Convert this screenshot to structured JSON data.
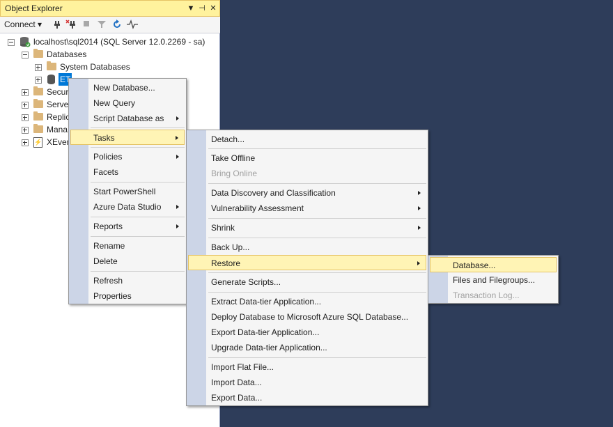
{
  "object_explorer": {
    "title": "Object Explorer",
    "title_buttons": [
      "▼",
      "⊣",
      "✕"
    ],
    "toolbar": {
      "connect_label": "Connect ▾"
    }
  },
  "tree": {
    "server": "localhost\\sql2014 (SQL Server 12.0.2269 - sa)",
    "databases": "Databases",
    "system_databases": "System Databases",
    "selected_db": "ET",
    "security": "Securi",
    "server_objects": "Server",
    "replication": "Replic",
    "management": "Mana",
    "xevent": "XEven"
  },
  "context_menu": {
    "items": [
      "New Database...",
      "New Query",
      "Script Database as",
      "Tasks",
      "Policies",
      "Facets",
      "Start PowerShell",
      "Azure Data Studio",
      "Reports",
      "Rename",
      "Delete",
      "Refresh",
      "Properties"
    ]
  },
  "tasks_menu": {
    "items": [
      "Detach...",
      "Take Offline",
      "Bring Online",
      "Data Discovery and Classification",
      "Vulnerability Assessment",
      "Shrink",
      "Back Up...",
      "Restore",
      "Generate Scripts...",
      "Extract Data-tier Application...",
      "Deploy Database to Microsoft Azure SQL Database...",
      "Export Data-tier Application...",
      "Upgrade Data-tier Application...",
      "Import Flat File...",
      "Import Data...",
      "Export Data..."
    ]
  },
  "restore_menu": {
    "items": [
      "Database...",
      "Files and Filegroups...",
      "Transaction Log..."
    ]
  },
  "colors": {
    "highlight": "#fff4b5",
    "gutter": "#ccd5e7",
    "workspace": "#2e3d5a",
    "selection": "#0078d7"
  }
}
